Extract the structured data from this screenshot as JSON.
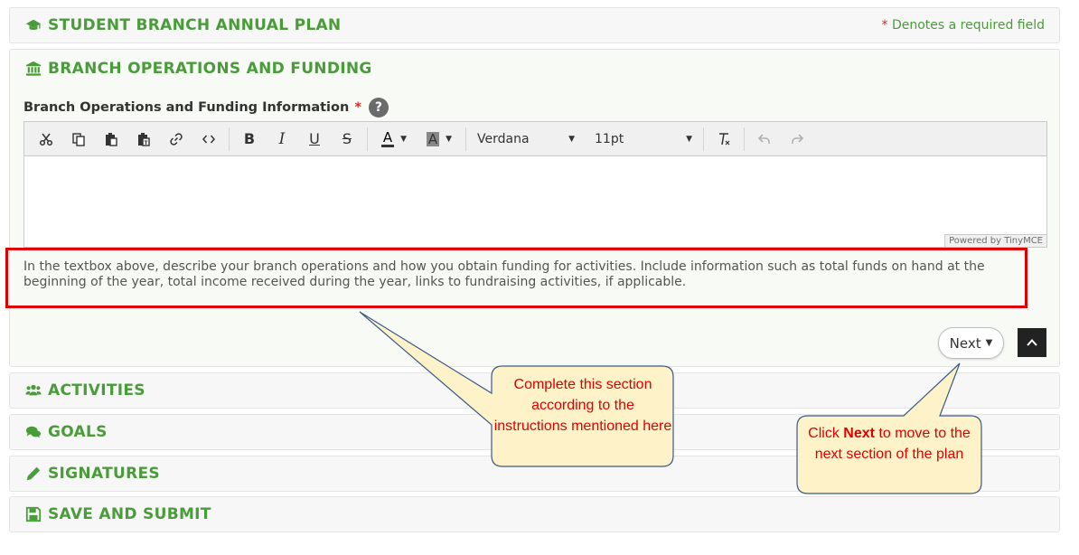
{
  "header": {
    "plan_title": "STUDENT BRANCH ANNUAL PLAN",
    "required_star": "*",
    "required_note": "Denotes a required field"
  },
  "sections": {
    "ops_title": "BRANCH OPERATIONS AND FUNDING",
    "activities_title": "ACTIVITIES",
    "goals_title": "GOALS",
    "signatures_title": "SIGNATURES",
    "save_title": "SAVE AND SUBMIT"
  },
  "form": {
    "field_label": "Branch Operations and Funding Information",
    "required_star": "*",
    "help": "?",
    "instructions": "In the textbox above, describe your branch operations and how you obtain funding for activities. Include information such as total funds on hand at the beginning of the year, total income received during the year, links to fundraising activities, if applicable."
  },
  "editor": {
    "bold": "B",
    "italic": "I",
    "underline": "U",
    "strikethrough": "S",
    "text_color": "A",
    "bg_color": "A",
    "font_family": "Verdana",
    "font_size": "11pt",
    "clear_format": "Tx",
    "powered_by": "Powered by TinyMCE"
  },
  "buttons": {
    "next_label": "Next"
  },
  "callouts": {
    "section_note": "Complete this section according to the instructions mentioned here",
    "next_note_prefix": "Click ",
    "next_note_bold": "Next",
    "next_note_suffix": " to move to the next section of the plan"
  },
  "colors": {
    "section_green": "#4a9c3b",
    "required_red": "#d02a2a",
    "highlight_red": "#e00000",
    "callout_fill": "#fdf2c8",
    "callout_border": "#3b5a8a"
  },
  "icons": {
    "plan": "graduation-cap-icon",
    "ops": "bank-icon",
    "activities": "users-icon",
    "goals": "comments-icon",
    "signatures": "pencil-icon",
    "save": "floppy-disk-icon"
  }
}
